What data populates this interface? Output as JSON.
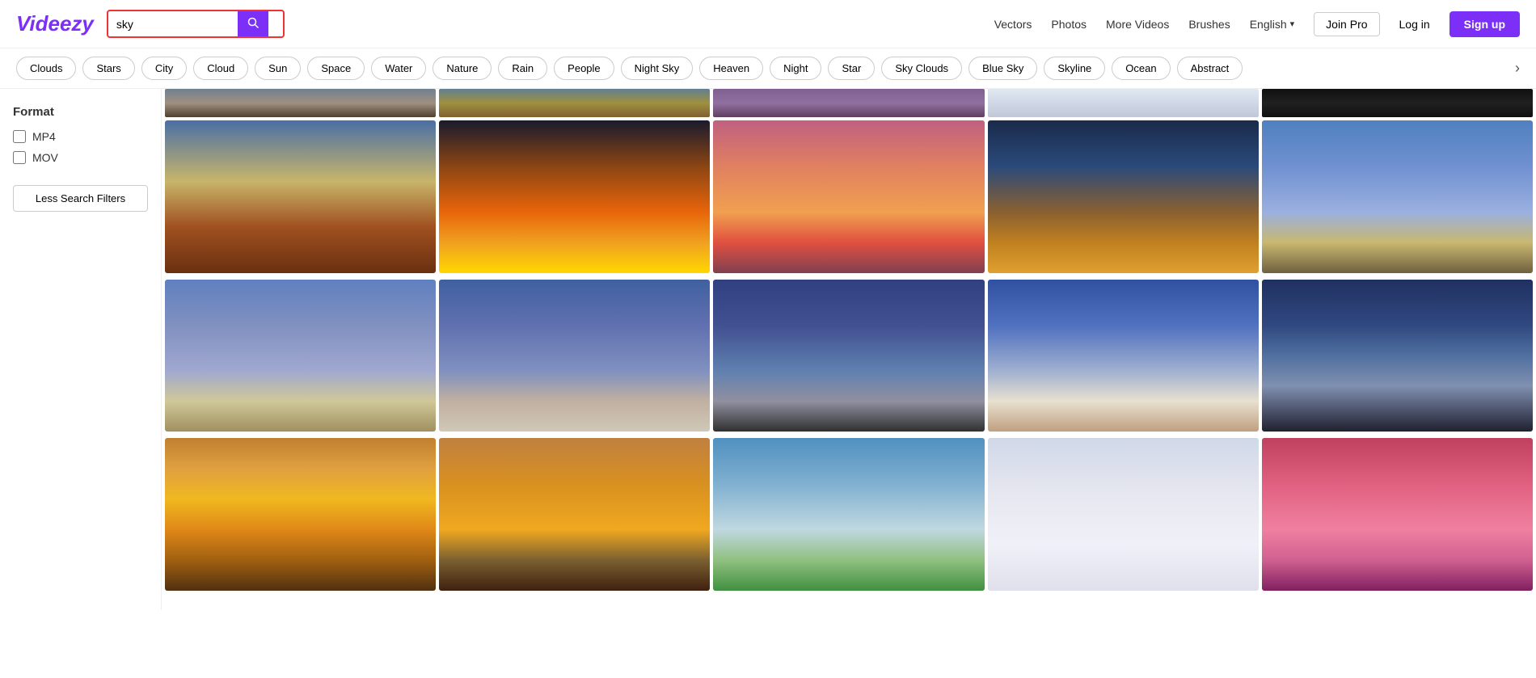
{
  "header": {
    "logo": "Videezy",
    "search_value": "sky",
    "search_placeholder": "sky",
    "nav": {
      "vectors": "Vectors",
      "photos": "Photos",
      "more_videos": "More Videos",
      "brushes": "Brushes"
    },
    "language": "English",
    "join_pro": "Join Pro",
    "login": "Log in",
    "signup": "Sign up"
  },
  "tags": [
    "Clouds",
    "Stars",
    "City",
    "Cloud",
    "Sun",
    "Space",
    "Water",
    "Nature",
    "Rain",
    "People",
    "Night Sky",
    "Heaven",
    "Night",
    "Star",
    "Sky Clouds",
    "Blue Sky",
    "Skyline",
    "Ocean",
    "Abstract"
  ],
  "sidebar": {
    "format_label": "Format",
    "mp4_label": "MP4",
    "mov_label": "MOV",
    "less_filters_btn": "Less Search Filters"
  },
  "grid": {
    "rows": [
      {
        "id": "row1",
        "thumbs": [
          "sky-1",
          "sky-2",
          "sky-3",
          "sky-4",
          "sky-5"
        ]
      },
      {
        "id": "row2",
        "thumbs": [
          "sky-6",
          "sky-7",
          "sky-8",
          "sky-9",
          "sky-10"
        ]
      },
      {
        "id": "row3",
        "thumbs": [
          "sky-11",
          "sky-13",
          "sky-15",
          "sky-16",
          "sky-17"
        ]
      }
    ]
  }
}
